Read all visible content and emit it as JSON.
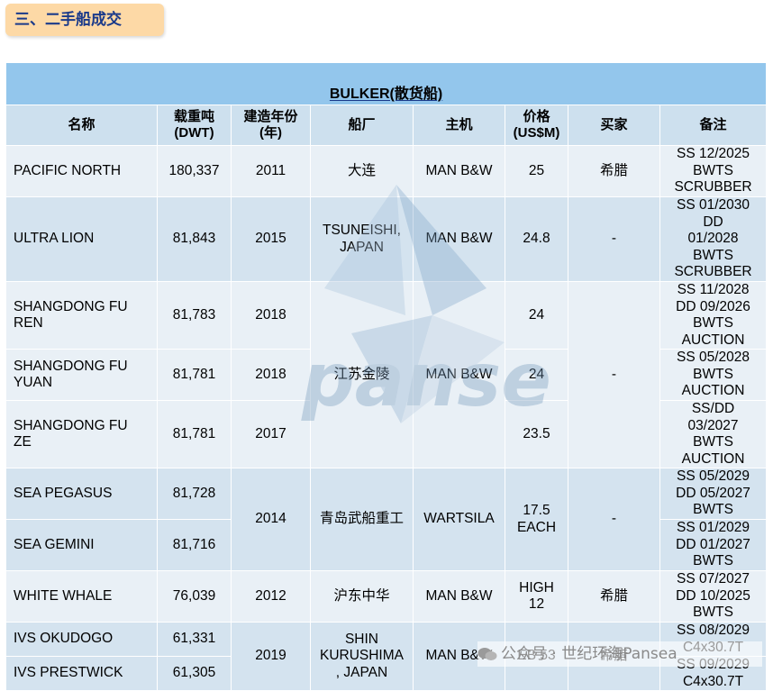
{
  "section_title": "三、二手船成交",
  "category": "BULKER(散货船)",
  "headers": {
    "name": "名称",
    "dwt": "载重吨\n(DWT)",
    "built": "建造年份\n(年)",
    "yard": "船厂",
    "engine": "主机",
    "price": "价格\n(US$M)",
    "buyer": "买家",
    "remark": "备注"
  },
  "rows": [
    {
      "name": "PACIFIC NORTH",
      "dwt": "180,337",
      "built": "2011",
      "yard": "大连",
      "engine": "MAN B&W",
      "price": "25",
      "buyer": "希腊",
      "remark": "SS 12/2025\nBWTS\nSCRUBBER"
    },
    {
      "name": "ULTRA LION",
      "dwt": "81,843",
      "built": "2015",
      "yard": "TSUNEISHI,\nJAPAN",
      "engine": "MAN B&W",
      "price": "24.8",
      "buyer": "-",
      "remark": "SS 01/2030\nDD\n01/2028\nBWTS\nSCRUBBER"
    },
    {
      "name": "SHANGDONG FU\nREN",
      "dwt": "81,783",
      "built": "2018",
      "yard": "江苏金陵",
      "engine": "MAN B&W",
      "price": "24",
      "buyer": "-",
      "remark": "SS 11/2028\nDD 09/2026\nBWTS\nAUCTION"
    },
    {
      "name": "SHANGDONG FU\nYUAN",
      "dwt": "81,781",
      "built": "2018",
      "price": "24",
      "remark": "SS 05/2028\nBWTS\nAUCTION"
    },
    {
      "name": "SHANGDONG FU\nZE",
      "dwt": "81,781",
      "built": "2017",
      "price": "23.5",
      "remark": "SS/DD\n03/2027\nBWTS\nAUCTION"
    },
    {
      "name": "SEA PEGASUS",
      "dwt": "81,728",
      "built": "2014",
      "yard": "青岛武船重工",
      "engine": "WARTSILA",
      "price": "17.5\nEACH",
      "buyer": "-",
      "remark": "SS 05/2029\nDD 05/2027\nBWTS"
    },
    {
      "name": "SEA GEMINI",
      "dwt": "81,716",
      "remark": "SS 01/2029\nDD 01/2027\nBWTS"
    },
    {
      "name": "WHITE WHALE",
      "dwt": "76,039",
      "built": "2012",
      "yard": "沪东中华",
      "engine": "MAN B&W",
      "price": "HIGH\n12",
      "buyer": "希腊",
      "remark": "SS 07/2027\nDD 10/2025\nBWTS"
    },
    {
      "name": "IVS OKUDOGO",
      "dwt": "61,331",
      "built": "2019",
      "yard": "SHIN\nKURUSHIMA\n, JAPAN",
      "engine": "MAN B&W",
      "price": "EB 53",
      "buyer": "希腊",
      "remark": "SS 08/2029\nC4x30.7T"
    },
    {
      "name": "IVS PRESTWICK",
      "dwt": "61,305",
      "remark": "SS 09/2029\nC4x30.7T"
    }
  ],
  "wechat_source": "公众号 · 世纪环海Pansea",
  "icons": {
    "watermark": "pansea-logo-watermark",
    "wechat": "wechat-icon"
  },
  "colors": {
    "category_bg": "#93c6ec",
    "header_bg": "#cde0ee",
    "row_light": "#e9f0f6",
    "row_blue": "#d4e3ef",
    "title_bg": "#fdd9a6",
    "title_text": "#1a3a8a"
  }
}
